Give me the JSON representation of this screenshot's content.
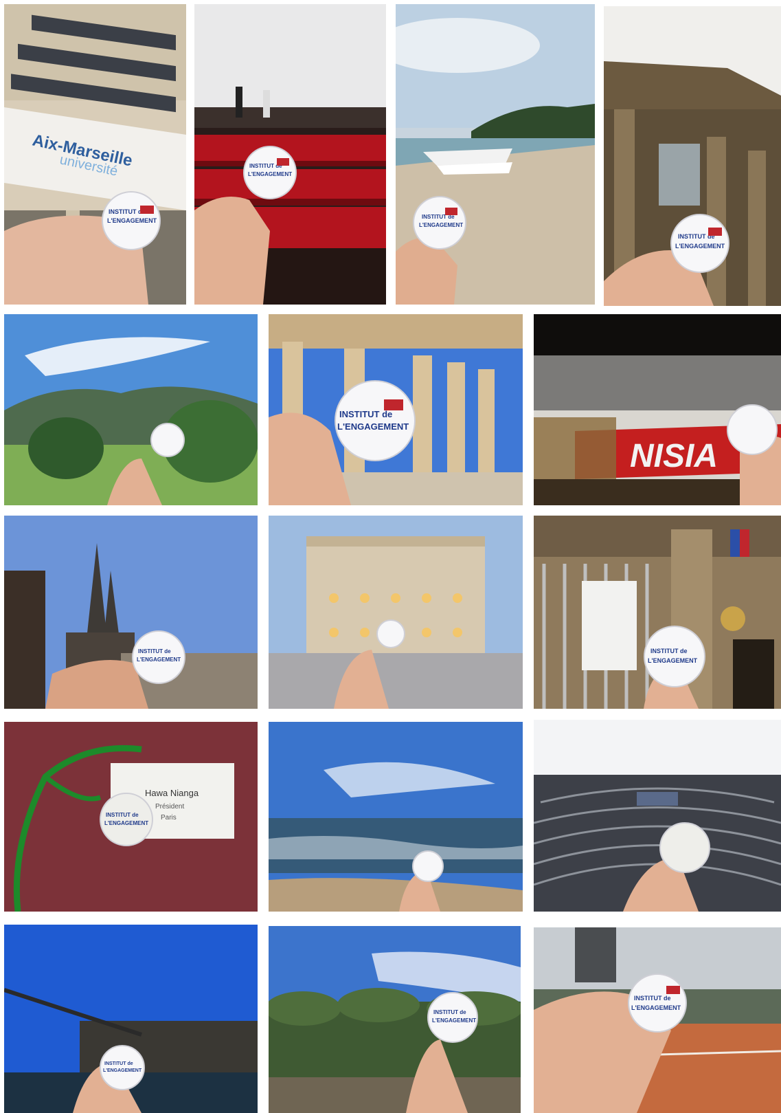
{
  "sign_text": {
    "line1": "Aix-Marseille",
    "line2": "université"
  },
  "badge": {
    "line1": "INSTITUT de",
    "line2": "L'ENGAGEMENT"
  },
  "cruise_ship_text": "NISIA",
  "name_badge": {
    "name": "Hawa Nianga",
    "line2": "Président",
    "line3": "Paris"
  },
  "colors": {
    "badge_blue": "#1f3a8a",
    "badge_red": "#c0262d",
    "sky": "#3d7fd4"
  },
  "photos": [
    {
      "scene": "aix-marseille-university-building"
    },
    {
      "scene": "cinema-hall"
    },
    {
      "scene": "beach-boats"
    },
    {
      "scene": "pantheon-columns"
    },
    {
      "scene": "mountain-valley"
    },
    {
      "scene": "parthenon"
    },
    {
      "scene": "cruise-ship-night"
    },
    {
      "scene": "cathedral-spires"
    },
    {
      "scene": "opera-house-square"
    },
    {
      "scene": "palace-gate"
    },
    {
      "scene": "name-badge-table"
    },
    {
      "scene": "sea-shore"
    },
    {
      "scene": "parliament-hemicycle"
    },
    {
      "scene": "mucem-building"
    },
    {
      "scene": "park-pond"
    },
    {
      "scene": "tennis-court"
    }
  ]
}
